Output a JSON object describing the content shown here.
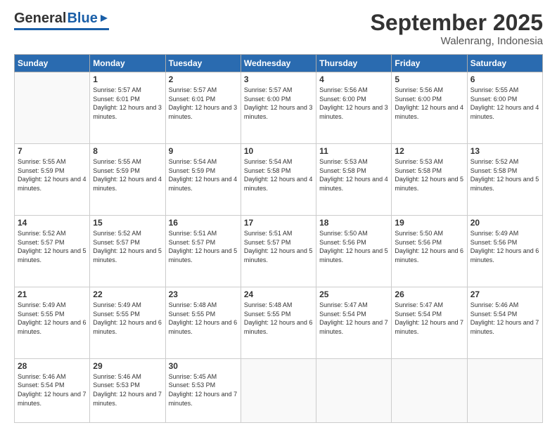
{
  "header": {
    "logo_general": "General",
    "logo_blue": "Blue",
    "month_title": "September 2025",
    "location": "Walenrang, Indonesia"
  },
  "weekdays": [
    "Sunday",
    "Monday",
    "Tuesday",
    "Wednesday",
    "Thursday",
    "Friday",
    "Saturday"
  ],
  "days": [
    {
      "date": "",
      "sunrise": "",
      "sunset": "",
      "daylight": ""
    },
    {
      "date": "1",
      "sunrise": "Sunrise: 5:57 AM",
      "sunset": "Sunset: 6:01 PM",
      "daylight": "Daylight: 12 hours and 3 minutes."
    },
    {
      "date": "2",
      "sunrise": "Sunrise: 5:57 AM",
      "sunset": "Sunset: 6:01 PM",
      "daylight": "Daylight: 12 hours and 3 minutes."
    },
    {
      "date": "3",
      "sunrise": "Sunrise: 5:57 AM",
      "sunset": "Sunset: 6:00 PM",
      "daylight": "Daylight: 12 hours and 3 minutes."
    },
    {
      "date": "4",
      "sunrise": "Sunrise: 5:56 AM",
      "sunset": "Sunset: 6:00 PM",
      "daylight": "Daylight: 12 hours and 3 minutes."
    },
    {
      "date": "5",
      "sunrise": "Sunrise: 5:56 AM",
      "sunset": "Sunset: 6:00 PM",
      "daylight": "Daylight: 12 hours and 4 minutes."
    },
    {
      "date": "6",
      "sunrise": "Sunrise: 5:55 AM",
      "sunset": "Sunset: 6:00 PM",
      "daylight": "Daylight: 12 hours and 4 minutes."
    },
    {
      "date": "7",
      "sunrise": "Sunrise: 5:55 AM",
      "sunset": "Sunset: 5:59 PM",
      "daylight": "Daylight: 12 hours and 4 minutes."
    },
    {
      "date": "8",
      "sunrise": "Sunrise: 5:55 AM",
      "sunset": "Sunset: 5:59 PM",
      "daylight": "Daylight: 12 hours and 4 minutes."
    },
    {
      "date": "9",
      "sunrise": "Sunrise: 5:54 AM",
      "sunset": "Sunset: 5:59 PM",
      "daylight": "Daylight: 12 hours and 4 minutes."
    },
    {
      "date": "10",
      "sunrise": "Sunrise: 5:54 AM",
      "sunset": "Sunset: 5:58 PM",
      "daylight": "Daylight: 12 hours and 4 minutes."
    },
    {
      "date": "11",
      "sunrise": "Sunrise: 5:53 AM",
      "sunset": "Sunset: 5:58 PM",
      "daylight": "Daylight: 12 hours and 4 minutes."
    },
    {
      "date": "12",
      "sunrise": "Sunrise: 5:53 AM",
      "sunset": "Sunset: 5:58 PM",
      "daylight": "Daylight: 12 hours and 5 minutes."
    },
    {
      "date": "13",
      "sunrise": "Sunrise: 5:52 AM",
      "sunset": "Sunset: 5:58 PM",
      "daylight": "Daylight: 12 hours and 5 minutes."
    },
    {
      "date": "14",
      "sunrise": "Sunrise: 5:52 AM",
      "sunset": "Sunset: 5:57 PM",
      "daylight": "Daylight: 12 hours and 5 minutes."
    },
    {
      "date": "15",
      "sunrise": "Sunrise: 5:52 AM",
      "sunset": "Sunset: 5:57 PM",
      "daylight": "Daylight: 12 hours and 5 minutes."
    },
    {
      "date": "16",
      "sunrise": "Sunrise: 5:51 AM",
      "sunset": "Sunset: 5:57 PM",
      "daylight": "Daylight: 12 hours and 5 minutes."
    },
    {
      "date": "17",
      "sunrise": "Sunrise: 5:51 AM",
      "sunset": "Sunset: 5:57 PM",
      "daylight": "Daylight: 12 hours and 5 minutes."
    },
    {
      "date": "18",
      "sunrise": "Sunrise: 5:50 AM",
      "sunset": "Sunset: 5:56 PM",
      "daylight": "Daylight: 12 hours and 5 minutes."
    },
    {
      "date": "19",
      "sunrise": "Sunrise: 5:50 AM",
      "sunset": "Sunset: 5:56 PM",
      "daylight": "Daylight: 12 hours and 6 minutes."
    },
    {
      "date": "20",
      "sunrise": "Sunrise: 5:49 AM",
      "sunset": "Sunset: 5:56 PM",
      "daylight": "Daylight: 12 hours and 6 minutes."
    },
    {
      "date": "21",
      "sunrise": "Sunrise: 5:49 AM",
      "sunset": "Sunset: 5:55 PM",
      "daylight": "Daylight: 12 hours and 6 minutes."
    },
    {
      "date": "22",
      "sunrise": "Sunrise: 5:49 AM",
      "sunset": "Sunset: 5:55 PM",
      "daylight": "Daylight: 12 hours and 6 minutes."
    },
    {
      "date": "23",
      "sunrise": "Sunrise: 5:48 AM",
      "sunset": "Sunset: 5:55 PM",
      "daylight": "Daylight: 12 hours and 6 minutes."
    },
    {
      "date": "24",
      "sunrise": "Sunrise: 5:48 AM",
      "sunset": "Sunset: 5:55 PM",
      "daylight": "Daylight: 12 hours and 6 minutes."
    },
    {
      "date": "25",
      "sunrise": "Sunrise: 5:47 AM",
      "sunset": "Sunset: 5:54 PM",
      "daylight": "Daylight: 12 hours and 7 minutes."
    },
    {
      "date": "26",
      "sunrise": "Sunrise: 5:47 AM",
      "sunset": "Sunset: 5:54 PM",
      "daylight": "Daylight: 12 hours and 7 minutes."
    },
    {
      "date": "27",
      "sunrise": "Sunrise: 5:46 AM",
      "sunset": "Sunset: 5:54 PM",
      "daylight": "Daylight: 12 hours and 7 minutes."
    },
    {
      "date": "28",
      "sunrise": "Sunrise: 5:46 AM",
      "sunset": "Sunset: 5:54 PM",
      "daylight": "Daylight: 12 hours and 7 minutes."
    },
    {
      "date": "29",
      "sunrise": "Sunrise: 5:46 AM",
      "sunset": "Sunset: 5:53 PM",
      "daylight": "Daylight: 12 hours and 7 minutes."
    },
    {
      "date": "30",
      "sunrise": "Sunrise: 5:45 AM",
      "sunset": "Sunset: 5:53 PM",
      "daylight": "Daylight: 12 hours and 7 minutes."
    }
  ]
}
